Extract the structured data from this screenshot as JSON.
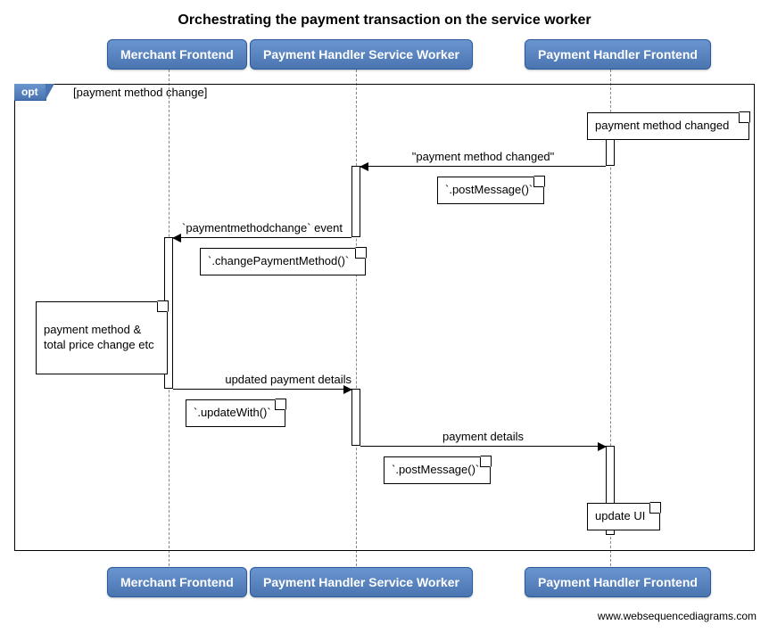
{
  "title": "Orchestrating the payment transaction on the service worker",
  "participants": {
    "merchant": "Merchant Frontend",
    "sw": "Payment Handler Service Worker",
    "frontend": "Payment Handler Frontend"
  },
  "opt": {
    "label": "opt",
    "condition": "[payment method change]"
  },
  "notes": {
    "pm_changed": "payment method changed",
    "post_msg1": "`.postMessage()`",
    "change_method": "`.changePaymentMethod()`",
    "merchant_change": "payment method &\ntotal price change etc",
    "update_with": "`.updateWith()`",
    "post_msg2": "`.postMessage()`",
    "update_ui": "update UI"
  },
  "messages": {
    "m1": "\"payment method changed\"",
    "m2": "`paymentmethodchange` event",
    "m3": "updated payment details",
    "m4": "payment details"
  },
  "credit": "www.websequencediagrams.com",
  "chart_data": {
    "type": "sequence-diagram",
    "title": "Orchestrating the payment transaction on the service worker",
    "participants": [
      "Merchant Frontend",
      "Payment Handler Service Worker",
      "Payment Handler Frontend"
    ],
    "fragments": [
      {
        "type": "opt",
        "condition": "payment method change",
        "steps": [
          {
            "type": "note",
            "on": "Payment Handler Frontend",
            "text": "payment method changed"
          },
          {
            "type": "message",
            "from": "Payment Handler Frontend",
            "to": "Payment Handler Service Worker",
            "text": "\"payment method changed\"",
            "note": "`.postMessage()`"
          },
          {
            "type": "message",
            "from": "Payment Handler Service Worker",
            "to": "Merchant Frontend",
            "text": "`paymentmethodchange` event",
            "note": "`.changePaymentMethod()`"
          },
          {
            "type": "note",
            "on": "Merchant Frontend",
            "text": "payment method & total price change etc"
          },
          {
            "type": "message",
            "from": "Merchant Frontend",
            "to": "Payment Handler Service Worker",
            "text": "updated payment details",
            "note": "`.updateWith()`"
          },
          {
            "type": "message",
            "from": "Payment Handler Service Worker",
            "to": "Payment Handler Frontend",
            "text": "payment details",
            "note": "`.postMessage()`"
          },
          {
            "type": "note",
            "on": "Payment Handler Frontend",
            "text": "update UI"
          }
        ]
      }
    ]
  }
}
